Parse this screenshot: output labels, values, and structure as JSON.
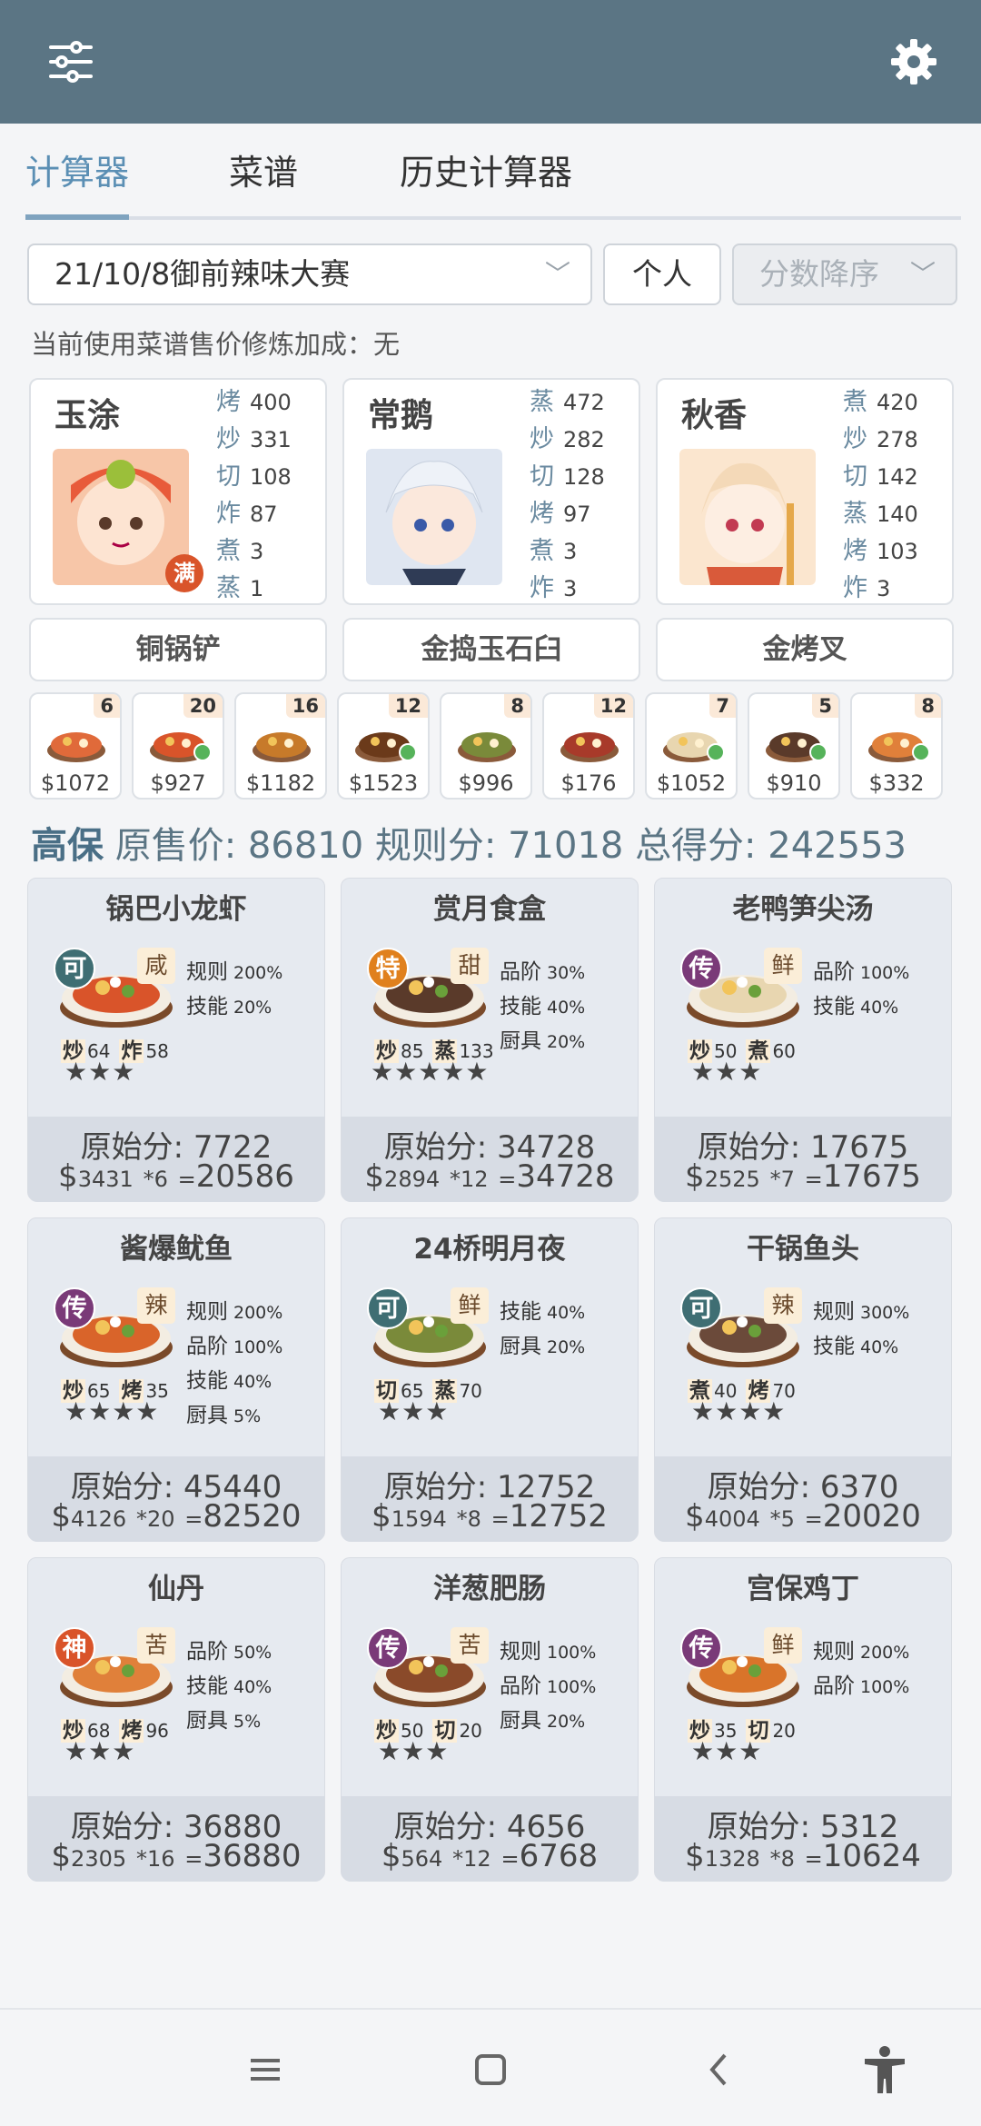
{
  "icons": {
    "filter": "sliders-icon",
    "settings": "gear-icon"
  },
  "tabs": [
    {
      "label": "计算器"
    },
    {
      "label": "菜谱"
    },
    {
      "label": "历史计算器"
    }
  ],
  "filters": {
    "contest": "21/10/8御前辣味大赛",
    "mode": "个人",
    "sort": "分数降序"
  },
  "note": "当前使用菜谱售价修炼加成：无",
  "chefs": [
    {
      "name": "玉涂",
      "badge": "满",
      "stats": [
        {
          "k": "烤",
          "v": "400"
        },
        {
          "k": "炒",
          "v": "331"
        },
        {
          "k": "切",
          "v": "108"
        },
        {
          "k": "炸",
          "v": "87"
        },
        {
          "k": "煮",
          "v": "3"
        },
        {
          "k": "蒸",
          "v": "1"
        }
      ]
    },
    {
      "name": "常鹅",
      "badge": "",
      "stats": [
        {
          "k": "蒸",
          "v": "472"
        },
        {
          "k": "炒",
          "v": "282"
        },
        {
          "k": "切",
          "v": "128"
        },
        {
          "k": "烤",
          "v": "97"
        },
        {
          "k": "煮",
          "v": "3"
        },
        {
          "k": "炸",
          "v": "3"
        }
      ]
    },
    {
      "name": "秋香",
      "badge": "",
      "stats": [
        {
          "k": "煮",
          "v": "420"
        },
        {
          "k": "炒",
          "v": "278"
        },
        {
          "k": "切",
          "v": "142"
        },
        {
          "k": "蒸",
          "v": "140"
        },
        {
          "k": "烤",
          "v": "103"
        },
        {
          "k": "炸",
          "v": "3"
        }
      ]
    }
  ],
  "tools": [
    "铜锅铲",
    "金捣玉石臼",
    "金烤叉"
  ],
  "ingredients": [
    {
      "count": "6",
      "price": "$1072",
      "checked": false
    },
    {
      "count": "20",
      "price": "$927",
      "checked": true
    },
    {
      "count": "16",
      "price": "$1182",
      "checked": false
    },
    {
      "count": "12",
      "price": "$1523",
      "checked": true
    },
    {
      "count": "8",
      "price": "$996",
      "checked": false
    },
    {
      "count": "12",
      "price": "$176",
      "checked": false
    },
    {
      "count": "7",
      "price": "$1052",
      "checked": true
    },
    {
      "count": "5",
      "price": "$910",
      "checked": true
    },
    {
      "count": "8",
      "price": "$332",
      "checked": true
    }
  ],
  "summary": {
    "grade": "高保",
    "orig_label": "原售价:",
    "orig": "86810",
    "rule_label": "规则分:",
    "rule": "71018",
    "total_label": "总得分:",
    "total": "242553"
  },
  "dishes": [
    {
      "name": "锅巴小龙虾",
      "rarity": "可",
      "rarity_color": "#3f6e73",
      "flavor": "咸",
      "skills": [
        {
          "k": "规则",
          "v": "200%"
        },
        {
          "k": "技能",
          "v": "20%"
        }
      ],
      "levels": [
        {
          "k": "炒",
          "v": "64"
        },
        {
          "k": "炸",
          "v": "58"
        }
      ],
      "stars": "★★★",
      "orig_label": "原始分:",
      "orig": "7722",
      "price": "3431",
      "qty": "*6",
      "score": "20586"
    },
    {
      "name": "赏月食盒",
      "rarity": "特",
      "rarity_color": "#e0801d",
      "flavor": "甜",
      "skills": [
        {
          "k": "品阶",
          "v": "30%"
        },
        {
          "k": "技能",
          "v": "40%"
        },
        {
          "k": "厨具",
          "v": "20%"
        }
      ],
      "levels": [
        {
          "k": "炒",
          "v": "85"
        },
        {
          "k": "蒸",
          "v": "133"
        }
      ],
      "stars": "★★★★★",
      "orig_label": "原始分:",
      "orig": "34728",
      "price": "2894",
      "qty": "*12",
      "score": "34728"
    },
    {
      "name": "老鸭笋尖汤",
      "rarity": "传",
      "rarity_color": "#7a3a78",
      "flavor": "鲜",
      "skills": [
        {
          "k": "品阶",
          "v": "100%"
        },
        {
          "k": "技能",
          "v": "40%"
        }
      ],
      "levels": [
        {
          "k": "炒",
          "v": "50"
        },
        {
          "k": "煮",
          "v": "60"
        }
      ],
      "stars": "★★★",
      "orig_label": "原始分:",
      "orig": "17675",
      "price": "2525",
      "qty": "*7",
      "score": "17675"
    },
    {
      "name": "酱爆鱿鱼",
      "rarity": "传",
      "rarity_color": "#7a3a78",
      "flavor": "辣",
      "skills": [
        {
          "k": "规则",
          "v": "200%"
        },
        {
          "k": "品阶",
          "v": "100%"
        },
        {
          "k": "技能",
          "v": "40%"
        },
        {
          "k": "厨具",
          "v": "5%"
        }
      ],
      "levels": [
        {
          "k": "炒",
          "v": "65"
        },
        {
          "k": "烤",
          "v": "35"
        }
      ],
      "stars": "★★★★",
      "orig_label": "原始分:",
      "orig": "45440",
      "price": "4126",
      "qty": "*20",
      "score": "82520"
    },
    {
      "name": "24桥明月夜",
      "rarity": "可",
      "rarity_color": "#3f6e73",
      "flavor": "鲜",
      "skills": [
        {
          "k": "技能",
          "v": "40%"
        },
        {
          "k": "厨具",
          "v": "20%"
        }
      ],
      "levels": [
        {
          "k": "切",
          "v": "65"
        },
        {
          "k": "蒸",
          "v": "70"
        }
      ],
      "stars": "★★★",
      "orig_label": "原始分:",
      "orig": "12752",
      "price": "1594",
      "qty": "*8",
      "score": "12752"
    },
    {
      "name": "干锅鱼头",
      "rarity": "可",
      "rarity_color": "#3f6e73",
      "flavor": "辣",
      "skills": [
        {
          "k": "规则",
          "v": "300%"
        },
        {
          "k": "技能",
          "v": "40%"
        }
      ],
      "levels": [
        {
          "k": "煮",
          "v": "40"
        },
        {
          "k": "烤",
          "v": "70"
        }
      ],
      "stars": "★★★★",
      "orig_label": "原始分:",
      "orig": "6370",
      "price": "4004",
      "qty": "*5",
      "score": "20020"
    },
    {
      "name": "仙丹",
      "rarity": "神",
      "rarity_color": "#d9542a",
      "flavor": "苦",
      "skills": [
        {
          "k": "品阶",
          "v": "50%"
        },
        {
          "k": "技能",
          "v": "40%"
        },
        {
          "k": "厨具",
          "v": "5%"
        }
      ],
      "levels": [
        {
          "k": "炒",
          "v": "68"
        },
        {
          "k": "烤",
          "v": "96"
        }
      ],
      "stars": "★★★",
      "orig_label": "原始分:",
      "orig": "36880",
      "price": "2305",
      "qty": "*16",
      "score": "36880"
    },
    {
      "name": "洋葱肥肠",
      "rarity": "传",
      "rarity_color": "#7a3a78",
      "flavor": "苦",
      "skills": [
        {
          "k": "规则",
          "v": "100%"
        },
        {
          "k": "品阶",
          "v": "100%"
        },
        {
          "k": "厨具",
          "v": "20%"
        }
      ],
      "levels": [
        {
          "k": "炒",
          "v": "50"
        },
        {
          "k": "切",
          "v": "20"
        }
      ],
      "stars": "★★★",
      "orig_label": "原始分:",
      "orig": "4656",
      "price": "564",
      "qty": "*12",
      "score": "6768"
    },
    {
      "name": "宫保鸡丁",
      "rarity": "传",
      "rarity_color": "#7a3a78",
      "flavor": "鲜",
      "skills": [
        {
          "k": "规则",
          "v": "200%"
        },
        {
          "k": "品阶",
          "v": "100%"
        }
      ],
      "levels": [
        {
          "k": "炒",
          "v": "35"
        },
        {
          "k": "切",
          "v": "20"
        }
      ],
      "stars": "★★★",
      "orig_label": "原始分:",
      "orig": "5312",
      "price": "1328",
      "qty": "*8",
      "score": "10624"
    }
  ],
  "nav": {
    "menu": "menu-icon",
    "home": "home-icon",
    "back": "back-icon",
    "accessibility": "accessibility-icon"
  }
}
